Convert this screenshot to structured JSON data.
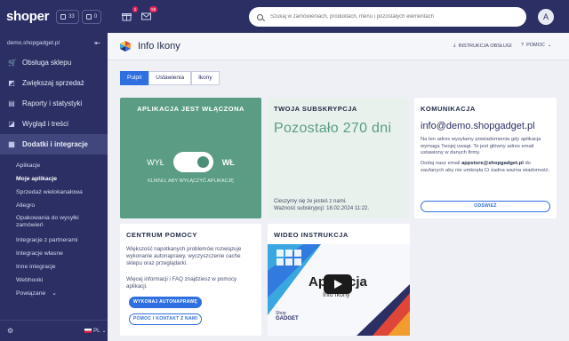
{
  "topbar": {
    "logo": "shoper",
    "counter1": "33",
    "counter2": "0",
    "notif_badge": "1",
    "mail_badge": "55",
    "search_placeholder": "Szukaj w zamówieniach, produktach, menu i pozostałych elementach",
    "avatar_letter": "A"
  },
  "sidebar": {
    "store": "demo.shopgadget.pl",
    "items": [
      {
        "label": "Obsługa sklepu",
        "icon": "cart-icon"
      },
      {
        "label": "Zwiększaj sprzedaż",
        "icon": "chart-icon"
      },
      {
        "label": "Raporty i statystyki",
        "icon": "report-icon"
      },
      {
        "label": "Wygląd i treści",
        "icon": "brush-icon"
      },
      {
        "label": "Dodatki i integracje",
        "icon": "grid-icon"
      }
    ],
    "sub_items": [
      "Aplikacje",
      "Moje aplikacje",
      "Sprzedaż wielokanałowa",
      "Allegro",
      "Opakowania do wysyłki zamówień",
      "Integracje z partnerami",
      "Integracje własne",
      "Inne integracje",
      "Webhooki",
      "Powiązane"
    ],
    "language": "PL"
  },
  "header": {
    "title": "Info Ikony",
    "link_instruction": "INSTRUKCJA OBSŁUGI",
    "link_help": "POMOC"
  },
  "tabs": [
    "Pulpit",
    "Ustawienia",
    "Ikony"
  ],
  "app_card": {
    "title": "APLIKACJA JEST WŁĄCZONA",
    "off_label": "WYŁ",
    "on_label": "WŁ",
    "hint": "KLIKNIJ, ABY WYŁĄCZYĆ APLIKACJĘ"
  },
  "sub_card": {
    "title": "TWOJA SUBSKRYPCJA",
    "remaining": "Pozostało 270 dni",
    "note1": "Cieszymy się że jesteś z nami.",
    "note2": "Ważność subskrypcji: 18.02.2024 11:22."
  },
  "kom_card": {
    "title": "KOMUNIKACJA",
    "email": "info@demo.shopgadget.pl",
    "p1": "Na ten adres wysyłamy powiadomienia gdy aplikacja wymaga Twojej uwagi. To jest główny adres email ustawiony w danych firmy.",
    "p2_pre": "Dodaj nasz email ",
    "p2_email": "appstore@shopgadget.pl",
    "p2_post": " do zaufanych aby nie umknęła Ci żadna ważna wiadomość.",
    "button": "ODŚWIEŻ"
  },
  "help_card": {
    "title": "CENTRUM POMOCY",
    "p1": "Większość napotkanych problemów rozwiązuje wykonanie autonaprawy, wyczyszczenie cache sklepu oraz przeglądarki.",
    "p2": "Więcej informacji i FAQ znajdziesz w pomocy aplikacji.",
    "btn_repair": "WYKONAJ AUTONAPRAWĘ",
    "btn_contact": "POMOC I KONTAKT Z NAMI"
  },
  "video_card": {
    "title": "WIDEO INSTRUKCJA",
    "video_title": "Aplikacja",
    "video_sub": "Info Ikony",
    "brand_small": "Shop",
    "brand_big": "GADGET"
  },
  "colors": {
    "nav": "#2b2f63",
    "accent": "#2f6fe0",
    "app_green": "#5b9d84",
    "sub_bg": "#e8f1ec"
  }
}
